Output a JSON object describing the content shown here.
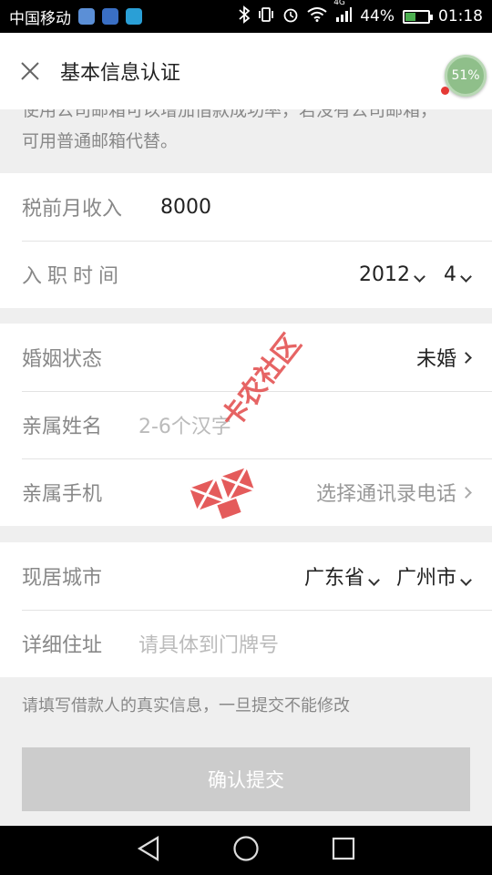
{
  "status_bar": {
    "carrier": "中国移动",
    "battery": "44%",
    "battery_level": 0.44,
    "network": "4G",
    "time": "01:18"
  },
  "header": {
    "title": "基本信息认证",
    "progress": "51%"
  },
  "email_note": "使用公司邮箱可以增加借款成功率，若没有公司邮箱，可用普通邮箱代替。",
  "income": {
    "label": "税前月收入",
    "value": "8000"
  },
  "employment": {
    "label": "入职时间",
    "year": "2012",
    "month": "4"
  },
  "marital": {
    "label": "婚姻状态",
    "value": "未婚"
  },
  "relative_name": {
    "label": "亲属姓名",
    "placeholder": "2-6个汉字"
  },
  "relative_phone": {
    "label": "亲属手机",
    "action": "选择通讯录电话"
  },
  "city": {
    "label": "现居城市",
    "province": "广东省",
    "city": "广州市"
  },
  "address": {
    "label": "详细住址",
    "placeholder": "请具体到门牌号"
  },
  "footer_note": "请填写借款人的真实信息，一旦提交不能修改",
  "submit_label": "确认提交",
  "watermark": "卡农社区"
}
